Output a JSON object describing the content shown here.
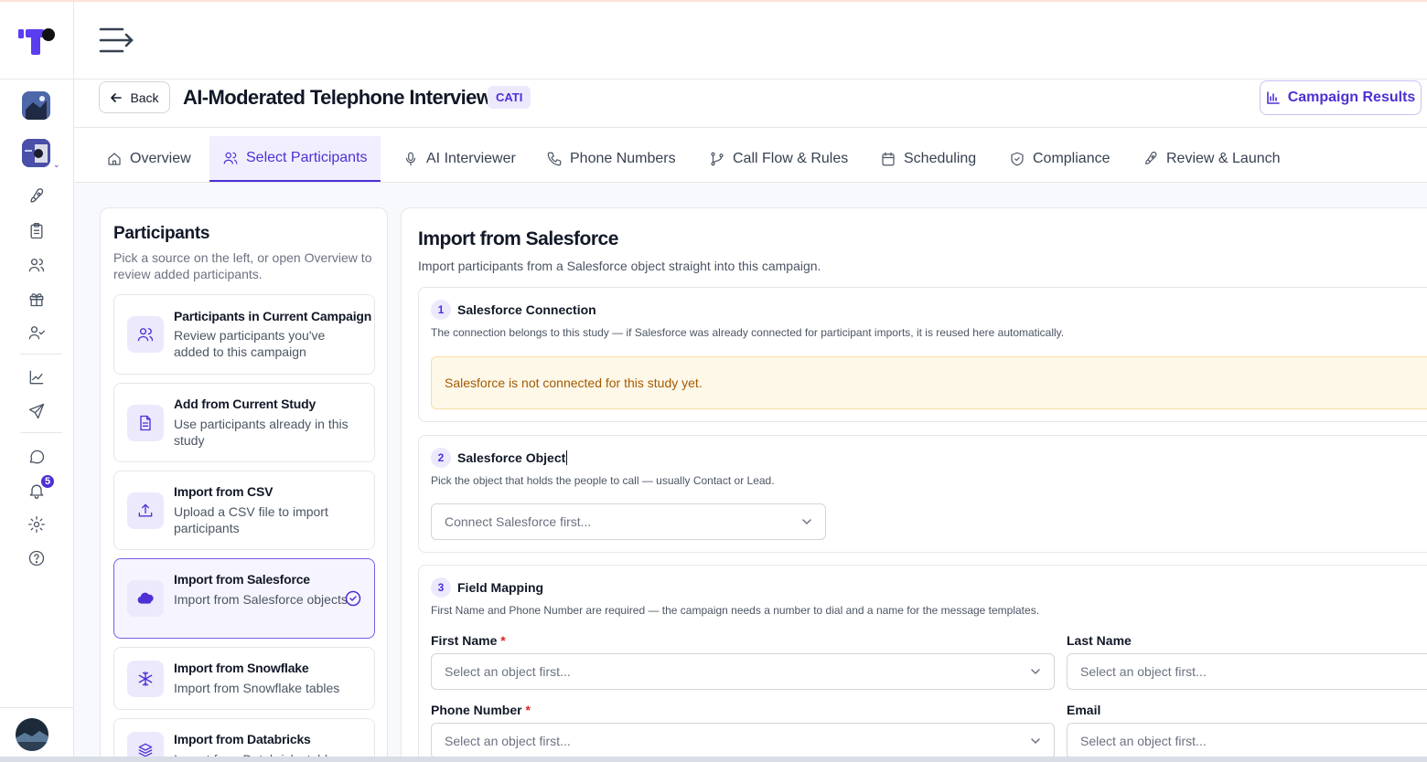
{
  "header": {
    "menu_icon": "menu-arrow-icon"
  },
  "titlebar": {
    "back_label": "Back",
    "title": "AI-Moderated Telephone Interview",
    "badge": "CATI",
    "results_label": "Campaign Results"
  },
  "tabs": [
    {
      "label": "Overview",
      "icon": "home-icon"
    },
    {
      "label": "Select Participants",
      "icon": "users-icon",
      "active": true
    },
    {
      "label": "AI Interviewer",
      "icon": "mic-icon"
    },
    {
      "label": "Phone Numbers",
      "icon": "phone-icon"
    },
    {
      "label": "Call Flow & Rules",
      "icon": "git-branch-icon"
    },
    {
      "label": "Scheduling",
      "icon": "calendar-icon"
    },
    {
      "label": "Compliance",
      "icon": "shield-check-icon"
    },
    {
      "label": "Review & Launch",
      "icon": "rocket-icon"
    }
  ],
  "sidebar": {
    "notification_count": "5",
    "icons": [
      "rocket-icon",
      "clipboard-icon",
      "users-icon",
      "gift-icon",
      "user-check-icon",
      "chart-icon",
      "send-icon",
      "chat-icon",
      "bell-icon",
      "settings-icon",
      "help-icon"
    ]
  },
  "participants": {
    "title": "Participants",
    "description": "Pick a source on the left, or open Overview to review added participants.",
    "sources": [
      {
        "title": "Participants in Current Campaign",
        "description": "Review participants you've added to this campaign"
      },
      {
        "title": "Add from Current Study",
        "description": "Use participants already in this study"
      },
      {
        "title": "Import from CSV",
        "description": "Upload a CSV file to import participants"
      },
      {
        "title": "Import from Salesforce",
        "description": "Import from Salesforce objects",
        "selected": true
      },
      {
        "title": "Import from Snowflake",
        "description": "Import from Snowflake tables"
      },
      {
        "title": "Import from Databricks",
        "description": "Import from Databricks tables"
      }
    ]
  },
  "main": {
    "title": "Import from Salesforce",
    "description": "Import participants from a Salesforce object straight into this campaign.",
    "connection": {
      "number": "1",
      "title": "Salesforce Connection",
      "description": "The connection belongs to this study — if Salesforce was already connected for participant imports, it is reused here automatically.",
      "warning": "Salesforce is not connected for this study yet."
    },
    "object": {
      "number": "2",
      "title": "Salesforce Object",
      "description": "Pick the object that holds the people to call — usually Contact or Lead.",
      "placeholder": "Connect Salesforce first..."
    },
    "mapping": {
      "number": "3",
      "title": "Field Mapping",
      "description": "First Name and Phone Number are required — the campaign needs a number to dial and a name for the message templates.",
      "fields": [
        {
          "label": "First Name",
          "required": "*",
          "placeholder": "Select an object first..."
        },
        {
          "label": "Last Name",
          "required": "",
          "placeholder": "Select an object first..."
        },
        {
          "label": "Phone Number",
          "required": "*",
          "placeholder": "Select an object first..."
        },
        {
          "label": "Email",
          "required": "",
          "placeholder": "Select an object first..."
        }
      ]
    }
  },
  "colors": {
    "accent": "#4f2fd6",
    "warning_text": "#a45a00",
    "warning_bg": "#fef8e9"
  }
}
